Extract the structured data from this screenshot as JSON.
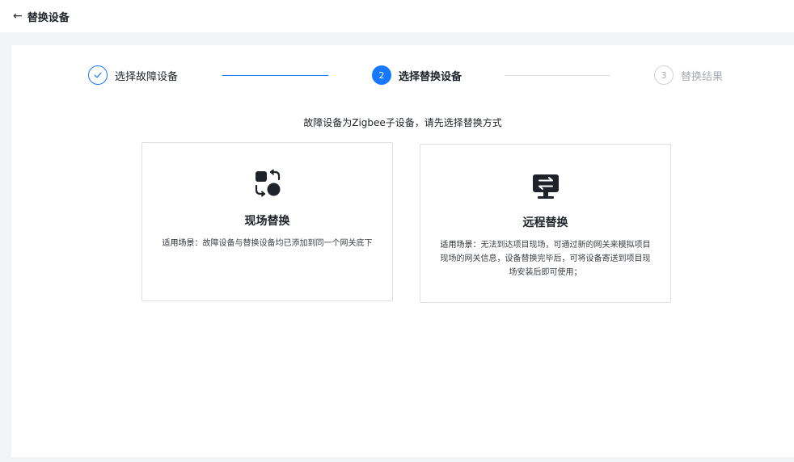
{
  "header": {
    "back_icon": "arrow-left-icon",
    "back_glyph": "←",
    "title": "替换设备"
  },
  "steps": [
    {
      "number": "",
      "label": "选择故障设备",
      "state": "done"
    },
    {
      "number": "2",
      "label": "选择替换设备",
      "state": "active"
    },
    {
      "number": "3",
      "label": "替换结果",
      "state": "pending"
    }
  ],
  "hint": "故障设备为Zigbee子设备，请先选择替换方式",
  "cards": {
    "onsite": {
      "icon": "swap-shapes-icon",
      "title": "现场替换",
      "desc_prefix": "适用场景：",
      "desc": "故障设备与替换设备均已添加到同一个网关底下"
    },
    "remote": {
      "icon": "monitor-swap-icon",
      "title": "远程替换",
      "desc_prefix": "适用场景：",
      "desc": "无法到达项目现场，可通过新的网关来模拟项目现场的网关信息，设备替换完毕后，可将设备寄送到项目现场安装后即可使用；"
    }
  },
  "colors": {
    "primary": "#1677ff",
    "icon_dark": "#1f2329",
    "pending": "#a8abb2"
  }
}
